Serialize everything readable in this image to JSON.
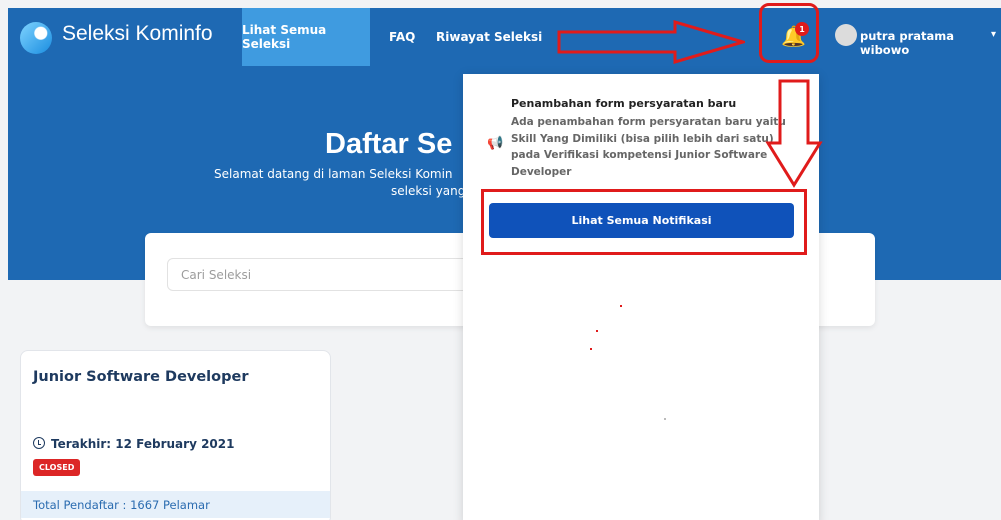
{
  "nav": {
    "brand": "Seleksi Kominfo",
    "items": [
      "Lihat Semua Seleksi",
      "FAQ",
      "Riwayat Seleksi"
    ],
    "notification_count": "1",
    "username": "putra pratama wibowo"
  },
  "hero": {
    "title": "Daftar Se",
    "subtitle_line1": "Selamat datang di laman Seleksi Komin",
    "subtitle_line2": "seleksi yang"
  },
  "search": {
    "placeholder": "Cari Seleksi"
  },
  "job": {
    "title": "Junior Software Developer",
    "deadline": "Terakhir: 12 February 2021",
    "status": "CLOSED",
    "total": "Total Pendaftar : 1667 Pelamar"
  },
  "notifications": {
    "items": [
      {
        "title": "Penambahan form persyaratan baru",
        "body": "Ada penambahan form persyaratan baru yaitu Skill Yang Dimiliki (bisa pilih lebih dari satu) pada Verifikasi kompetensi Junior Software Developer"
      }
    ],
    "see_all_label": "Lihat Semua Notifikasi"
  },
  "colors": {
    "hero": "#1e69b3",
    "nav_active": "#3f9be0",
    "primary_button": "#0f52ba",
    "annotation": "#e01b1b",
    "closed_badge": "#dc2626"
  }
}
